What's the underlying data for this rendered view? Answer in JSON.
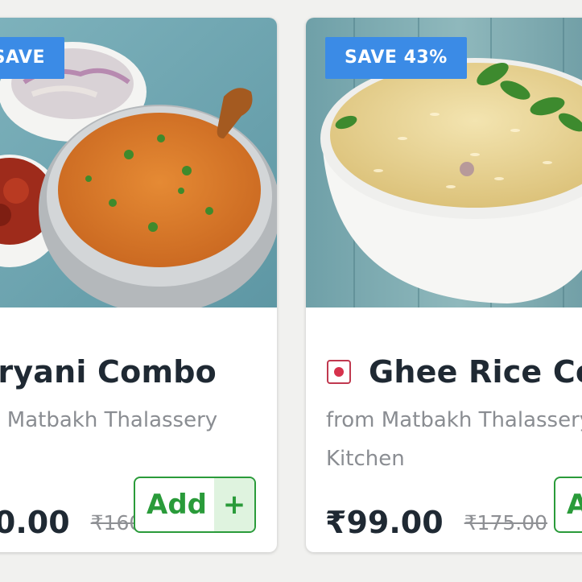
{
  "products": [
    {
      "save_badge": "SAVE 48%",
      "title": "Biryani Combo",
      "vendor": "from Matbakh Thalassery",
      "price": "₹80.00",
      "original_price": "₹160.00",
      "add_label": "Add",
      "add_plus": "+"
    },
    {
      "save_badge": "SAVE 43%",
      "title": "Ghee Rice Combo",
      "vendor": "from Matbakh Thalassery Kitchen",
      "price": "₹99.00",
      "original_price": "₹175.00",
      "add_label": "Add",
      "add_plus": "+"
    }
  ],
  "colors": {
    "save_badge_bg": "#3b8be6",
    "add_green": "#2a9b3a",
    "add_plus_bg": "#dff3df",
    "nonveg_mark": "#d6324c",
    "title_text": "#1f2933",
    "muted_text": "#8a8d92"
  }
}
